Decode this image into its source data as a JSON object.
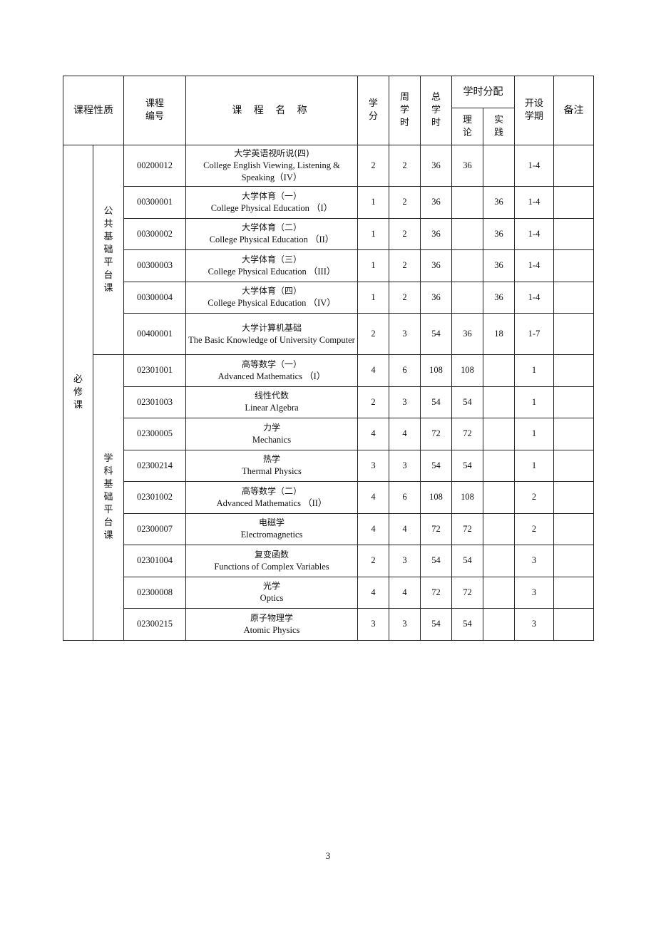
{
  "table": {
    "headers": {
      "nature": "课程性质",
      "code": "课程编号",
      "name": "课 程 名 称",
      "credits": "学分",
      "weekly_hours": "周学时",
      "total_hours": "总学时",
      "hours_allocation": "学时分配",
      "theory": "理论",
      "practice": "实践",
      "semester": "开设学期",
      "remarks": "备注"
    },
    "category": "必修课",
    "groups": [
      {
        "label": "公共基础平台课",
        "rows": [
          {
            "code": "00200012",
            "name_cn": "大学英语视听说(四)",
            "name_en": "College English Viewing, Listening & Speaking（IV）",
            "credits": "2",
            "weekly": "2",
            "total": "36",
            "theory": "36",
            "practice": "",
            "semester": "1-4",
            "remarks": ""
          },
          {
            "code": "00300001",
            "name_cn": "大学体育（一）",
            "name_en": "College Physical Education （I）",
            "credits": "1",
            "weekly": "2",
            "total": "36",
            "theory": "",
            "practice": "36",
            "semester": "1-4",
            "remarks": ""
          },
          {
            "code": "00300002",
            "name_cn": "大学体育（二）",
            "name_en": "College Physical Education （II）",
            "credits": "1",
            "weekly": "2",
            "total": "36",
            "theory": "",
            "practice": "36",
            "semester": "1-4",
            "remarks": ""
          },
          {
            "code": "00300003",
            "name_cn": "大学体育（三）",
            "name_en": "College Physical Education （III）",
            "credits": "1",
            "weekly": "2",
            "total": "36",
            "theory": "",
            "practice": "36",
            "semester": "1-4",
            "remarks": ""
          },
          {
            "code": "00300004",
            "name_cn": "大学体育（四）",
            "name_en": "College Physical Education （IV）",
            "credits": "1",
            "weekly": "2",
            "total": "36",
            "theory": "",
            "practice": "36",
            "semester": "1-4",
            "remarks": ""
          },
          {
            "code": "00400001",
            "name_cn": "大学计算机基础",
            "name_en": "The Basic Knowledge of University Computer",
            "credits": "2",
            "weekly": "3",
            "total": "54",
            "theory": "36",
            "practice": "18",
            "semester": "1-7",
            "remarks": ""
          }
        ]
      },
      {
        "label": "学科基础平台课",
        "rows": [
          {
            "code": "02301001",
            "name_cn": "高等数学（一）",
            "name_en": "Advanced Mathematics （I）",
            "credits": "4",
            "weekly": "6",
            "total": "108",
            "theory": "108",
            "practice": "",
            "semester": "1",
            "remarks": ""
          },
          {
            "code": "02301003",
            "name_cn": "线性代数",
            "name_en": "Linear Algebra",
            "credits": "2",
            "weekly": "3",
            "total": "54",
            "theory": "54",
            "practice": "",
            "semester": "1",
            "remarks": ""
          },
          {
            "code": "02300005",
            "name_cn": "力学",
            "name_en": "Mechanics",
            "credits": "4",
            "weekly": "4",
            "total": "72",
            "theory": "72",
            "practice": "",
            "semester": "1",
            "remarks": ""
          },
          {
            "code": "02300214",
            "name_cn": "热学",
            "name_en": "Thermal Physics",
            "credits": "3",
            "weekly": "3",
            "total": "54",
            "theory": "54",
            "practice": "",
            "semester": "1",
            "remarks": ""
          },
          {
            "code": "02301002",
            "name_cn": "高等数学（二）",
            "name_en": "Advanced Mathematics （II）",
            "credits": "4",
            "weekly": "6",
            "total": "108",
            "theory": "108",
            "practice": "",
            "semester": "2",
            "remarks": ""
          },
          {
            "code": "02300007",
            "name_cn": "电磁学",
            "name_en": "Electromagnetics",
            "credits": "4",
            "weekly": "4",
            "total": "72",
            "theory": "72",
            "practice": "",
            "semester": "2",
            "remarks": ""
          },
          {
            "code": "02301004",
            "name_cn": "复变函数",
            "name_en": "Functions of Complex Variables",
            "credits": "2",
            "weekly": "3",
            "total": "54",
            "theory": "54",
            "practice": "",
            "semester": "3",
            "remarks": ""
          },
          {
            "code": "02300008",
            "name_cn": "光学",
            "name_en": "Optics",
            "credits": "4",
            "weekly": "4",
            "total": "72",
            "theory": "72",
            "practice": "",
            "semester": "3",
            "remarks": ""
          },
          {
            "code": "02300215",
            "name_cn": "原子物理学",
            "name_en": "Atomic Physics",
            "credits": "3",
            "weekly": "3",
            "total": "54",
            "theory": "54",
            "practice": "",
            "semester": "3",
            "remarks": ""
          }
        ]
      }
    ]
  },
  "page_number": "3"
}
